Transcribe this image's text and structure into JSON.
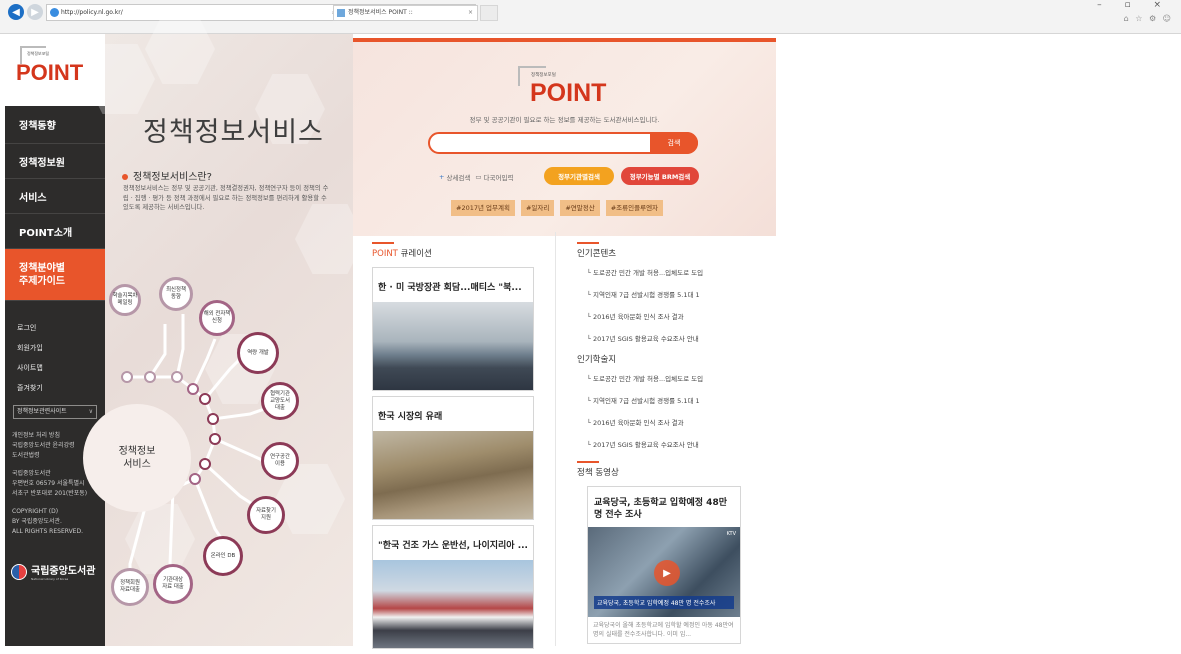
{
  "browser": {
    "url": "http://policy.nl.go.kr/",
    "url_tools": "⌕ ▾ ↻",
    "tab_title": "정책정보서비스 POINT :: ",
    "tab_close": "×",
    "window_controls": "–  ▫  ×",
    "toolbar_icons": "⌂ ☆ ⚙ ☺"
  },
  "sidebar": {
    "logo_small": "정책정보포털",
    "logo": "POINT",
    "menu": [
      "정책동향",
      "정책정보원",
      "서비스",
      "POINT소개",
      "정책분야별\n주제가이드"
    ],
    "links": [
      "로그인",
      "회원가입",
      "사이트맵",
      "즐겨찾기"
    ],
    "select_label": "정책정보관련사이트",
    "select_arrow": "∨",
    "notice": "개인정보 처리 방침\n국립중앙도서관 윤리강령\n도서관법령",
    "address": "국립중앙도서관\n우편번호 06579 서울특별시\n서초구 반포대로 201(반포동)",
    "copyright": "COPYRIGHT (D)\nBY 국립중앙도서관.\nALL RIGHTS RESERVED.",
    "org_name": "국립중앙도서관",
    "org_en": "National Library of Korea"
  },
  "intro": {
    "title": "정책정보서비스",
    "question": "정책정보서비스란?",
    "description": "정책정보서비스는 정부 및 공공기관, 정책결정권자, 정책연구자 등이 정책의 수립 · 집행 · 평가 등 정책 과정에서 필요로 하는 정책정보를 편리하게 활용할 수 있도록 제공하는 서비스입니다.",
    "center": "정책정보\n서비스",
    "nodes": [
      "학술지목차\n메일링",
      "최신정책\n동향",
      "해외 전자책\n신청",
      "역량 개발",
      "협력기관\n교양도서\n대출",
      "연구공간\n이용",
      "자료찾기\n지원",
      "온라인 DB",
      "기관대상\n자료 대출",
      "정책회원\n자료대출"
    ]
  },
  "hero": {
    "logo_small": "정책정보포털",
    "logo": "POINT",
    "tagline": "정부 및 공공기관이 필요로 하는 정보를 제공하는 도서관서비스입니다.",
    "search_placeholder": "",
    "search_button": "검색",
    "detail_search": "상세검색",
    "multi_input": "다국어입력",
    "detail_icon": "+",
    "keyboard_icon": "▭",
    "btn_org": "정부기관별검색",
    "btn_brm": "정부기능별 BRM검색",
    "tags": [
      "#2017년 업무계획",
      "#일자리",
      "#연말정산",
      "#조류인플루엔자"
    ]
  },
  "curation": {
    "title_point": "POINT",
    "title_rest": " 큐레이션",
    "cards": [
      "한 · 미 국방장관 회담...매티스 \"북...",
      "한국 시장의 유래",
      "\"한국 건조 가스 운반선, 나이지리아 ..."
    ]
  },
  "popular_contents": {
    "title": "인기콘텐츠",
    "items": [
      "도로공간 민간 개발 허용...입체도로 도입",
      "지역인재 7급 선발시험 경쟁률 5.1대 1",
      "2016년 육아문화 인식 조사 결과",
      "2017년 SGIS 활용교육 수요조사 안내"
    ]
  },
  "popular_journals": {
    "title": "인기학술지",
    "items": [
      "도로공간 민간 개발 허용...입체도로 도입",
      "지역인재 7급 선발시험 경쟁률 5.1대 1",
      "2016년 육아문화 인식 조사 결과",
      "2017년 SGIS 활용교육 수요조사 안내"
    ]
  },
  "policy_video": {
    "title": "정책 동영상",
    "video_title": "교육당국, 초등학교 입학예정 48만 명 전수 조사",
    "caption": "교육당국, 초등학교 입학예정 48만 명 전수조사",
    "channel": "KTV",
    "description": "교육당국이 올해 초등학교에 입학할 예정인 아동 48만여 명의 실태를 전수조사합니다. 이미 입..."
  }
}
